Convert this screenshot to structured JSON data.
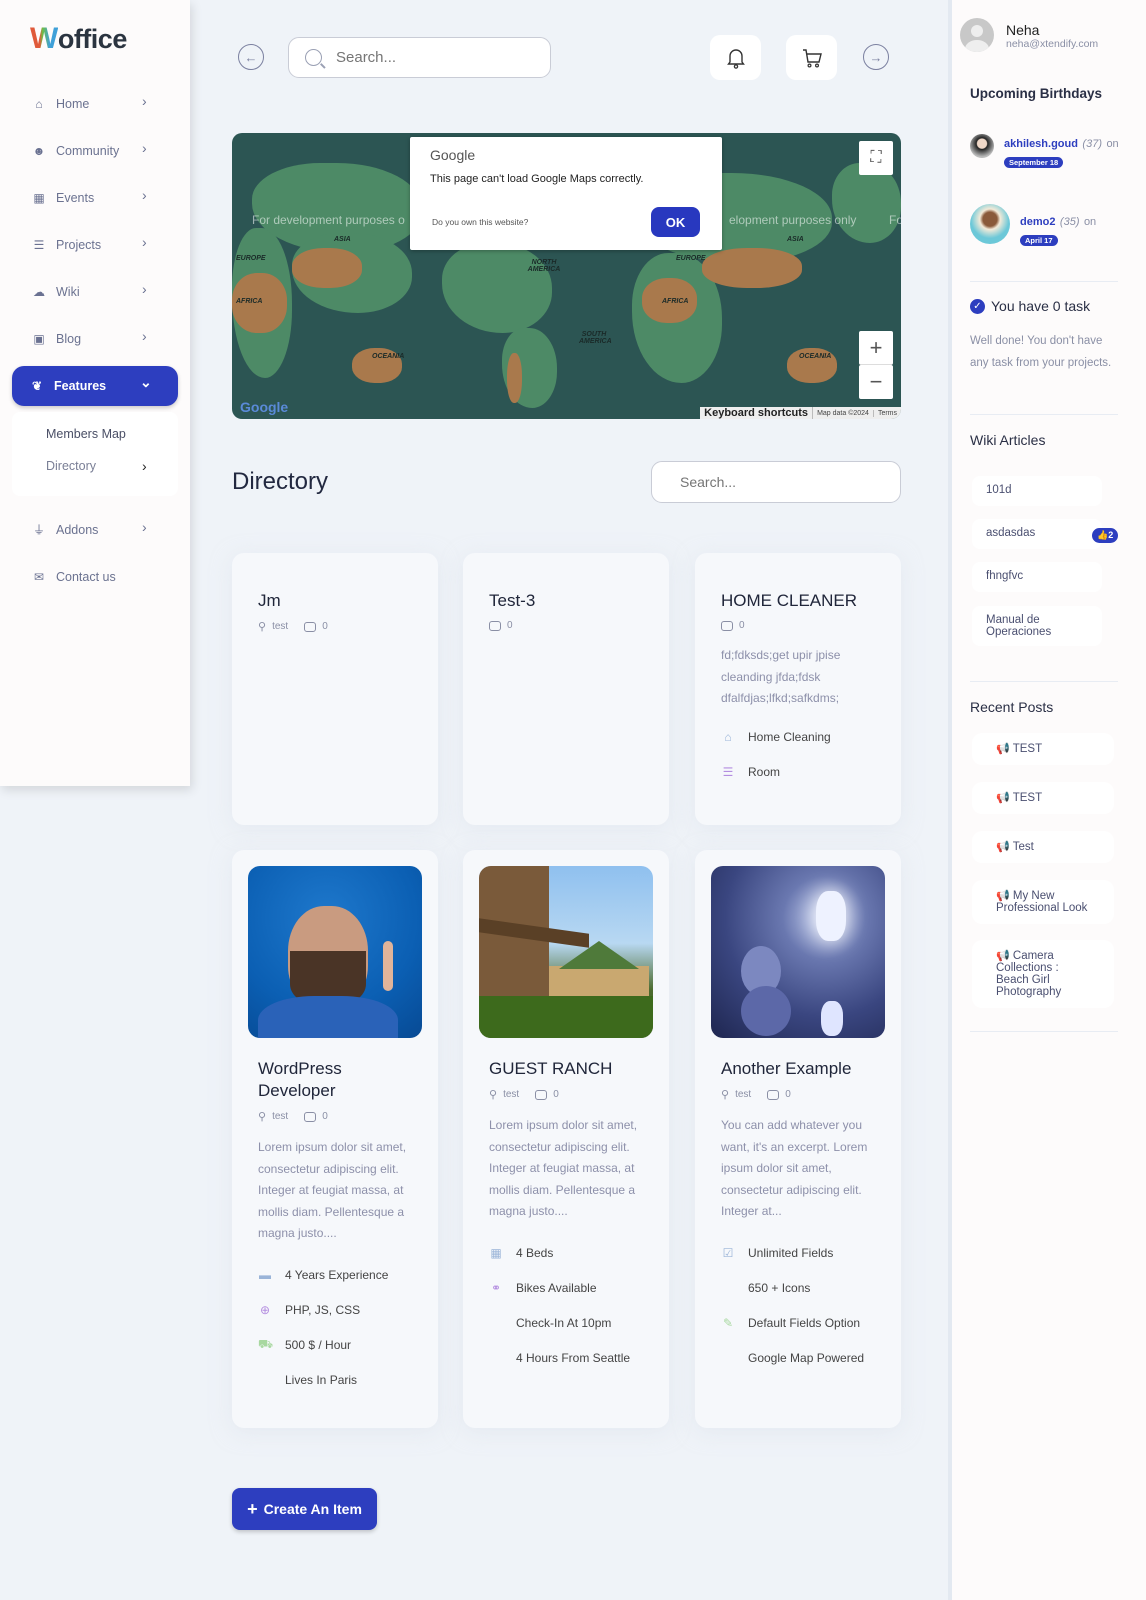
{
  "brand": {
    "logo_first": "W",
    "logo_rest": "office"
  },
  "sidebar": {
    "items": [
      {
        "label": "Home",
        "icon": "home-icon"
      },
      {
        "label": "Community",
        "icon": "users-icon"
      },
      {
        "label": "Events",
        "icon": "calendar-icon"
      },
      {
        "label": "Projects",
        "icon": "tasks-icon"
      },
      {
        "label": "Wiki",
        "icon": "wiki-icon"
      },
      {
        "label": "Blog",
        "icon": "blog-icon"
      },
      {
        "label": "Features",
        "icon": "leaf-icon",
        "active": true
      },
      {
        "label": "Addons",
        "icon": "plug-icon"
      },
      {
        "label": "Contact us",
        "icon": "envelope-icon"
      }
    ],
    "submenu": [
      {
        "label": "Members Map"
      },
      {
        "label": "Directory"
      }
    ]
  },
  "topbar": {
    "search_placeholder": "Search..."
  },
  "map": {
    "dialog_title": "Google",
    "dialog_message": "This page can't load Google Maps correctly.",
    "dialog_question": "Do you own this website?",
    "dialog_ok": "OK",
    "dev_text_left": "For development purposes o",
    "dev_text_right": "elopment purposes only",
    "dev_text_edge": "Fo",
    "labels": [
      "ASIA",
      "EUROPE",
      "AFRICA",
      "NORTH AMERICA",
      "SOUTH AMERICA",
      "OCEANIA",
      "EUROPE",
      "ASIA",
      "AFRICA",
      "OCEANIA"
    ],
    "google_logo": "Google",
    "keyboard_shortcuts": "Keyboard shortcuts",
    "map_data": "Map data ©2024",
    "terms": "Terms",
    "zoom_in": "+",
    "zoom_out": "−"
  },
  "directory": {
    "title": "Directory",
    "search_placeholder": "Search...",
    "create_label": "Create An Item",
    "cards": [
      {
        "title": "Jm",
        "category": "test",
        "comments": "0"
      },
      {
        "title": "Test-3",
        "comments": "0"
      },
      {
        "title": "HOME CLEANER",
        "comments": "0",
        "excerpt": "fd;fdksds;get upir jpise cleanding jfda;fdsk dfalfdjas;lfkd;safkdms;",
        "features": [
          {
            "icon": "home-icon",
            "label": "Home Cleaning",
            "color": "#9ab4d8"
          },
          {
            "icon": "room-icon",
            "label": "Room",
            "color": "#b48ee0"
          }
        ]
      },
      {
        "title": "WordPress Developer",
        "category": "test",
        "comments": "0",
        "excerpt": "Lorem ipsum dolor sit amet, consectetur adipiscing elit. Integer at feugiat massa, at mollis diam. Pellentesque a magna justo....",
        "features": [
          {
            "icon": "briefcase-icon",
            "label": "4 Years Experience",
            "color": "#9ab4d8"
          },
          {
            "icon": "crosshair-icon",
            "label": "PHP, JS, CSS",
            "color": "#b48ee0"
          },
          {
            "icon": "cart-icon",
            "label": "500 $ / Hour",
            "color": "#a8d8a0"
          },
          {
            "icon": "",
            "label": "Lives In Paris"
          }
        ]
      },
      {
        "title": "GUEST RANCH",
        "category": "test",
        "comments": "0",
        "excerpt": "Lorem ipsum dolor sit amet, consectetur adipiscing elit. Integer at feugiat massa, at mollis diam. Pellentesque a magna justo....",
        "features": [
          {
            "icon": "building-icon",
            "label": "4 Beds",
            "color": "#9ab4d8"
          },
          {
            "icon": "bicycle-icon",
            "label": "Bikes Available",
            "color": "#b48ee0"
          },
          {
            "icon": "",
            "label": "Check-In At 10pm"
          },
          {
            "icon": "",
            "label": "4 Hours From Seattle"
          }
        ]
      },
      {
        "title": "Another Example",
        "category": "test",
        "comments": "0",
        "excerpt": "You can add whatever you want, it's an excerpt. Lorem ipsum dolor sit amet, consectetur adipiscing elit. Integer at...",
        "features": [
          {
            "icon": "checkbox-icon",
            "label": "Unlimited Fields",
            "color": "#9ab4d8"
          },
          {
            "icon": "",
            "label": "650 + Icons"
          },
          {
            "icon": "magic-wand-icon",
            "label": "Default Fields Option",
            "color": "#a8d8a0"
          },
          {
            "icon": "",
            "label": "Google Map Powered"
          }
        ]
      }
    ]
  },
  "user": {
    "name": "Neha",
    "email": "neha@xtendify.com"
  },
  "right": {
    "birthdays_title": "Upcoming Birthdays",
    "birthdays": [
      {
        "name": "akhilesh.goud",
        "age": "(37)",
        "on": "on",
        "date": "September 18"
      },
      {
        "name": "demo2",
        "age": "(35)",
        "on": "on",
        "date": "April 17"
      }
    ],
    "tasks_title": "You have 0 task",
    "tasks_desc": "Well done! You don't have any task from your projects.",
    "wiki_title": "Wiki Articles",
    "wiki": [
      {
        "label": "101d"
      },
      {
        "label": "asdasdas",
        "likes": "2"
      },
      {
        "label": "fhngfvc"
      },
      {
        "label": "Manual de Operaciones"
      }
    ],
    "posts_title": "Recent Posts",
    "posts": [
      {
        "label": "TEST"
      },
      {
        "label": "TEST"
      },
      {
        "label": "Test"
      },
      {
        "label": "My New Professional Look"
      },
      {
        "label": "Camera Collections : Beach Girl Photography"
      }
    ]
  },
  "colors": {
    "accent": "#2d3ebf",
    "background": "#eff3f8"
  }
}
